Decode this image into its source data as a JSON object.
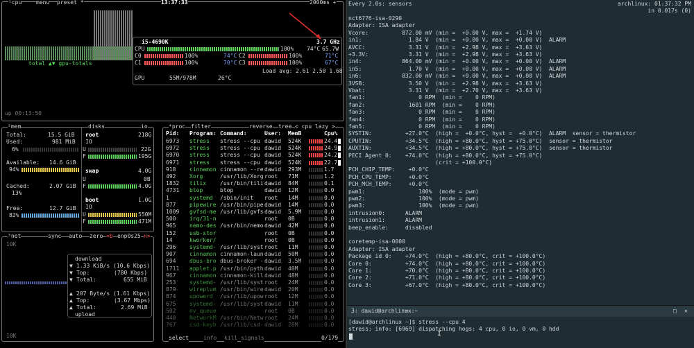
{
  "btop": {
    "top_bar": {
      "cpu_tab": "¹cpu",
      "menu": "menu",
      "preset": "preset *",
      "time": "13:37:33",
      "interval": "2000ms +"
    },
    "cpu": {
      "model": "i5-4690K",
      "freq": "3.7 GHz",
      "cpu_label": "CPU",
      "cpu_pct": "100%",
      "cpu_temp": "74°C",
      "cpu_watts": "65.7W",
      "cores": [
        {
          "label": "C0",
          "pct": "100%",
          "temp": "74°C"
        },
        {
          "label": "C2",
          "pct": "100%",
          "temp": "71°C"
        },
        {
          "label": "C1",
          "pct": "100%",
          "temp": "70°C"
        },
        {
          "label": "C3",
          "pct": "100%",
          "temp": "67°C"
        }
      ],
      "load_avg": "Load avg: 2.61 2.50 1.68",
      "gpu_label": "GPU",
      "gpu_mem": "55M/978M",
      "gpu_temp": "26°C",
      "graph_caption": "total ▲▼ gpu-totals",
      "uptime": "up 00:13:50"
    },
    "mem": {
      "title": "²mem",
      "total_label": "Total:",
      "total_val": "15.5 GiB",
      "used_label": "Used:",
      "used_val": "981 MiB",
      "used_pct": "6%",
      "avail_label": "Available:",
      "avail_val": "14.6 GiB",
      "avail_pct": "94%",
      "cached_label": "Cached:",
      "cached_val": "2.07 GiB",
      "cached_pct": "13%",
      "free_label": "Free:",
      "free_val": "12.7 GiB",
      "free_pct": "82%"
    },
    "disks": {
      "title": "disks",
      "io_tab": "io",
      "root": "root",
      "root_size": "218G",
      "root_io": "IO",
      "root_u": "U",
      "root_u_val": "22G",
      "root_f": "F",
      "root_f_val": "195G",
      "swap": "swap",
      "swap_size": "4.0G",
      "swap_u": "U",
      "swap_u_val": "0B",
      "swap_f": "F",
      "swap_f_val": "4.0G",
      "boot": "boot",
      "boot_size": "1.0G",
      "boot_io": "IO",
      "boot_u": "U",
      "boot_u_val": "550M",
      "boot_f": "F",
      "boot_f_val": "471M"
    },
    "net": {
      "title": "³net",
      "sync": "sync",
      "auto": "auto",
      "zero": "zero",
      "b": "<b",
      "iface": "enp0s25",
      "n": "n>",
      "scale_top": "10K",
      "scale_bottom": "10K",
      "download": "download",
      "dl_rate": "1.33 KiB/s (10.6 Kbps)",
      "dl_top_label": "Top:",
      "dl_top": "(780 Kbps)",
      "dl_total_label": "Total:",
      "dl_total": "655 MiB",
      "ul_rate": "207 Byte/s (1.61 Kbps)",
      "ul_top_label": "Top:",
      "ul_top": "(3.67 Mbps)",
      "ul_total_label": "Total:",
      "ul_total": "2.69 MiB",
      "upload": "upload"
    },
    "proc": {
      "title": "⁴proc",
      "filter": "filter",
      "reverse": "reverse",
      "tree": "tree",
      "sort": "< cpu lazy >",
      "headers": [
        "Pid:",
        "Program:",
        "Command:",
        "User:",
        "MemB",
        "Cpu%"
      ],
      "rows": [
        {
          "pid": "6973",
          "prog": "stress",
          "cmd": "stress --cpu",
          "user": "dawid",
          "mem": "524K",
          "cpu": "24.4",
          "hot": true
        },
        {
          "pid": "6972",
          "prog": "stress",
          "cmd": "stress --cpu",
          "user": "dawid",
          "mem": "524K",
          "cpu": "24.9",
          "hot": true
        },
        {
          "pid": "6970",
          "prog": "stress",
          "cmd": "stress --cpu",
          "user": "dawid",
          "mem": "524K",
          "cpu": "24.2",
          "hot": true
        },
        {
          "pid": "6971",
          "prog": "stress",
          "cmd": "stress --cpu",
          "user": "dawid",
          "mem": "524K",
          "cpu": "22.7",
          "hot": true
        },
        {
          "pid": "918",
          "prog": "cinnamon",
          "cmd": "cinnamon --re",
          "user": "dawid",
          "mem": "293M",
          "cpu": "1.7",
          "hot": false
        },
        {
          "pid": "492",
          "prog": "Xorg",
          "cmd": "/usr/lib/Xorg",
          "user": "root",
          "mem": "71M",
          "cpu": "1.2",
          "hot": false
        },
        {
          "pid": "1832",
          "prog": "tilix",
          "cmd": "/usr/bin/tili",
          "user": "dawid",
          "mem": "84M",
          "cpu": "0.1",
          "hot": false
        },
        {
          "pid": "4731",
          "prog": "btop",
          "cmd": "btop",
          "user": "dawid",
          "mem": "12M",
          "cpu": "0.0",
          "hot": false
        },
        {
          "pid": "1",
          "prog": "systemd",
          "cmd": "/sbin/init",
          "user": "root",
          "mem": "14M",
          "cpu": "0.0",
          "hot": false
        },
        {
          "pid": "877",
          "prog": "pipewire",
          "cmd": "/usr/bin/pipe",
          "user": "dawid",
          "mem": "14M",
          "cpu": "0.0",
          "hot": false
        },
        {
          "pid": "1009",
          "prog": "gvfsd-me",
          "cmd": "/usr/lib/gvfs",
          "user": "dawid",
          "mem": "5.9M",
          "cpu": "0.0",
          "hot": false
        },
        {
          "pid": "500",
          "prog": "irq/31-n",
          "cmd": "",
          "user": "root",
          "mem": "0B",
          "cpu": "0.0",
          "hot": false
        },
        {
          "pid": "965",
          "prog": "nemo-des",
          "cmd": "/usr/bin/nemo",
          "user": "dawid",
          "mem": "42M",
          "cpu": "0.0",
          "hot": false
        },
        {
          "pid": "152",
          "prog": "usb-stor",
          "cmd": "",
          "user": "root",
          "mem": "0B",
          "cpu": "0.0",
          "hot": false
        },
        {
          "pid": "14",
          "prog": "kworker/",
          "cmd": "",
          "user": "root",
          "mem": "0B",
          "cpu": "0.0",
          "hot": false
        },
        {
          "pid": "296",
          "prog": "systemd-",
          "cmd": "/usr/lib/syst",
          "user": "root",
          "mem": "11M",
          "cpu": "0.0",
          "hot": false
        },
        {
          "pid": "907",
          "prog": "cinnamon",
          "cmd": "cinnamon-laun",
          "user": "dawid",
          "mem": "50M",
          "cpu": "0.0",
          "hot": false
        },
        {
          "pid": "694",
          "prog": "dbus-bro",
          "cmd": "dbus-broker -",
          "user": "dawid",
          "mem": "3.5M",
          "cpu": "0.0",
          "hot": false
        },
        {
          "pid": "1711",
          "prog": "applet.p",
          "cmd": "/usr/bin/pyth",
          "user": "dawid",
          "mem": "40M",
          "cpu": "0.0",
          "hot": false
        },
        {
          "pid": "967",
          "prog": "cinnamon",
          "cmd": "cinnamon-kill",
          "user": "dawid",
          "mem": "48M",
          "cpu": "0.0",
          "hot": false
        },
        {
          "pid": "253",
          "prog": "systemd-",
          "cmd": "/usr/lib/syst",
          "user": "root",
          "mem": "24M",
          "cpu": "0.0",
          "hot": false
        },
        {
          "pid": "879",
          "prog": "wireplum",
          "cmd": "/usr/bin/wire",
          "user": "dawid",
          "mem": "20M",
          "cpu": "0.0",
          "hot": false
        },
        {
          "pid": "874",
          "prog": "upowerd",
          "cmd": "/usr/lib/upow",
          "user": "root",
          "mem": "12M",
          "cpu": "0.0",
          "hot": false
        },
        {
          "pid": "675",
          "prog": "systemd-",
          "cmd": "/usr/lib/syst",
          "user": "dawid",
          "mem": "11M",
          "cpu": "0.0",
          "hot": false
        },
        {
          "pid": "502",
          "prog": "nv_queue",
          "cmd": "",
          "user": "root",
          "mem": "0B",
          "cpu": "0.0",
          "hot": false
        },
        {
          "pid": "440",
          "prog": "NetworkM",
          "cmd": "/usr/bin/Netw",
          "user": "root",
          "mem": "24M",
          "cpu": "0.0",
          "hot": false
        },
        {
          "pid": "767",
          "prog": "csd-keyb",
          "cmd": "/usr/lib/csd-",
          "user": "dawid",
          "mem": "28M",
          "cpu": "0.0",
          "hot": false
        }
      ],
      "footer_select": "select",
      "footer_info": "info",
      "footer_kill": "kill",
      "footer_signals": "signals",
      "footer_count": "0/179"
    }
  },
  "sensors": {
    "header_left": "Every 2.0s: sensors",
    "header_right": "archlinux: 01:37:32 PM",
    "header_right2": "in 0.017s (0)",
    "lines": [
      "nct6776-isa-0290",
      "Adapter: ISA adapter",
      "Vcore:          872.00 mV (min =  +0.00 V, max =  +1.74 V)",
      "in1:              1.84 V  (min =  +0.00 V, max =  +0.00 V)  ALARM",
      "AVCC:             3.31 V  (min =  +2.98 V, max =  +3.63 V)",
      "+3.3V:            3.31 V  (min =  +2.98 V, max =  +3.63 V)",
      "in4:            864.00 mV (min =  +0.00 V, max =  +0.00 V)  ALARM",
      "in5:              1.70 V  (min =  +0.00 V, max =  +0.00 V)  ALARM",
      "in6:            832.00 mV (min =  +0.00 V, max =  +0.00 V)  ALARM",
      "3VSB:             3.50 V  (min =  +2.98 V, max =  +3.63 V)",
      "Vbat:             3.31 V  (min =  +2.70 V, max =  +3.63 V)",
      "fan1:                0 RPM  (min =    0 RPM)",
      "fan2:             1601 RPM  (min =    0 RPM)",
      "fan3:                0 RPM  (min =    0 RPM)",
      "fan4:                0 RPM  (min =    0 RPM)",
      "fan5:                0 RPM  (min =    0 RPM)",
      "SYSTIN:          +27.0°C  (high =  +0.0°C, hyst =  +0.0°C)  ALARM  sensor = thermistor",
      "CPUTIN:          +34.5°C  (high = +80.0°C, hyst = +75.0°C)  sensor = thermistor",
      "AUXTIN:          +34.5°C  (high = +80.0°C, hyst = +75.0°C)  sensor = thermistor",
      "PECI Agent 0:    +74.0°C  (high = +80.0°C, hyst = +75.0°C)",
      "                          (crit = +100.0°C)",
      "PCH_CHIP_TEMP:    +0.0°C",
      "PCH_CPU_TEMP:     +0.0°C",
      "PCH_MCH_TEMP:     +0.0°C",
      "pwm1:                100%  (mode = pwm)",
      "pwm2:                100%  (mode = pwm)",
      "pwm3:                100%  (mode = pwm)",
      "intrusion0:      ALARM",
      "intrusion1:      ALARM",
      "beep_enable:     disabled",
      "",
      "coretemp-isa-0000",
      "Adapter: ISA adapter",
      "Package id 0:    +74.0°C  (high = +80.0°C, crit = +100.0°C)",
      "Core 0:          +74.0°C  (high = +80.0°C, crit = +100.0°C)",
      "Core 1:          +70.0°C  (high = +80.0°C, crit = +100.0°C)",
      "Core 2:          +71.0°C  (high = +80.0°C, crit = +100.0°C)",
      "Core 3:          +67.0°C  (high = +80.0°C, crit = +100.0°C)"
    ]
  },
  "terminal": {
    "tab_title": "3: dawid@archlinux:~",
    "tab_caret": "▾",
    "btn_restore": "□",
    "btn_close": "✕",
    "prompt": "[dawid@archlinux ~]$ stress --cpu 4",
    "output": "stress: info: [6969] dispatching hogs: 4 cpu, 0 io, 0 vm, 0 hdd"
  },
  "colors": {
    "hot": "#ff4444",
    "green": "#5dd55d",
    "bg_right": "#1f2d33"
  }
}
